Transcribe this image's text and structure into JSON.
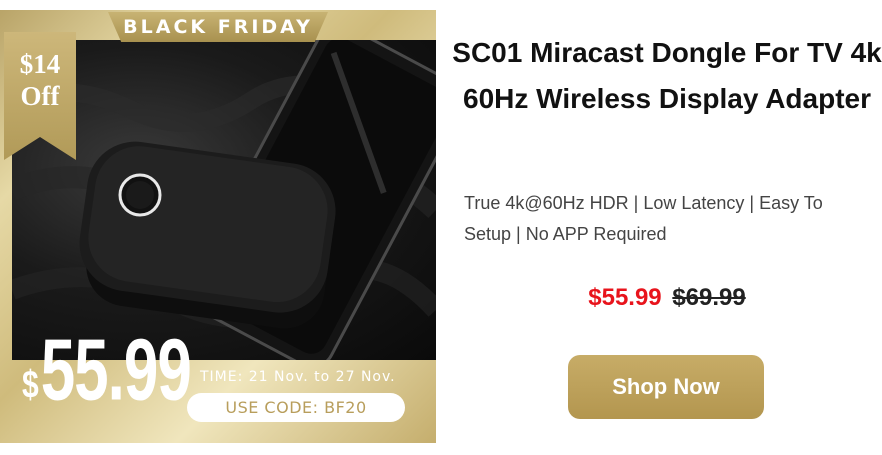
{
  "product_image": {
    "banner_label": "BLACK FRIDAY",
    "discount_amount": "$14",
    "discount_off": "Off",
    "price_currency": "$",
    "price_value": "55.99",
    "promo_time": "TIME: 21 Nov. to 27 Nov.",
    "promo_code": "USE CODE: BF20"
  },
  "product": {
    "title": "SC01 Miracast Dongle For TV 4k 60Hz Wireless Display Adapter",
    "subtitle": "True 4k@60Hz HDR | Low Latency | Easy To Setup | No APP Required",
    "sale_price": "$55.99",
    "original_price": "$69.99",
    "cta_label": "Shop Now"
  },
  "colors": {
    "accent_gold": "#b89e5c",
    "sale_red": "#e8141c",
    "text_dark": "#111111"
  }
}
